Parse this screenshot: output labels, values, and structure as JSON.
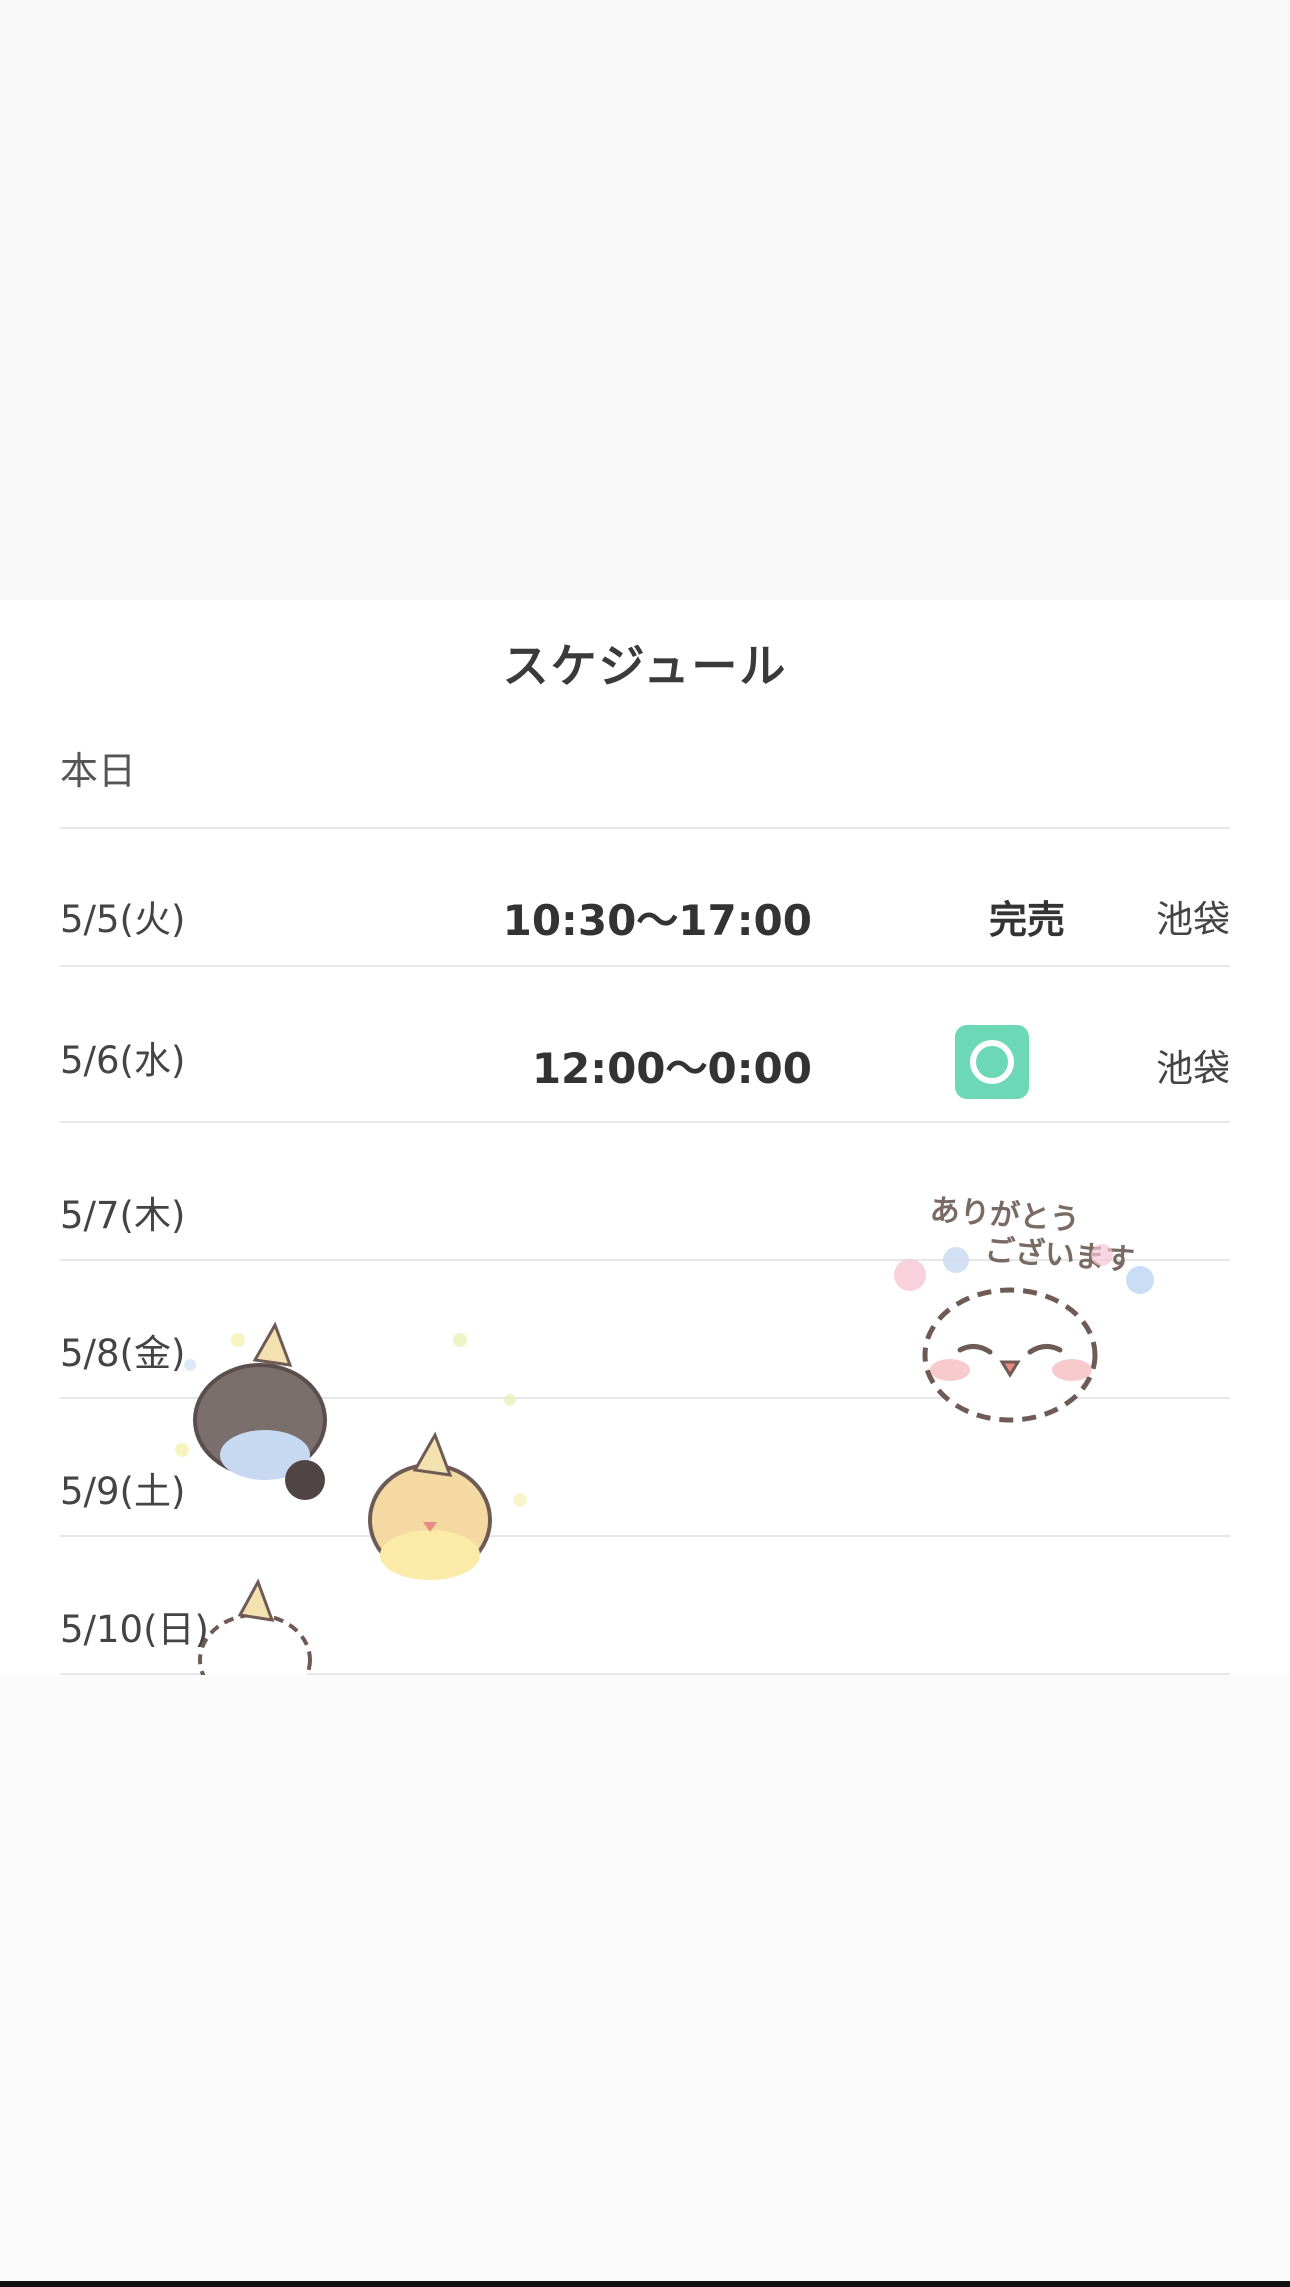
{
  "schedule": {
    "title": "スケジュール",
    "today_label": "本日",
    "rows": [
      {
        "date": "5/5(火)",
        "time": "10:30〜17:00",
        "status": "完売",
        "location": "池袋"
      },
      {
        "date": "5/6(水)",
        "time": "12:00〜0:00",
        "status_icon": "available-circle-icon",
        "location": "池袋"
      },
      {
        "date": "5/7(木)"
      },
      {
        "date": "5/8(金)"
      },
      {
        "date": "5/9(土)"
      },
      {
        "date": "5/10(日)"
      }
    ]
  },
  "sticker": {
    "thanks_line1": "ありがとう",
    "thanks_line2": "ございます"
  },
  "colors": {
    "available_badge": "#6dd8b5",
    "card_background": "#ffffff",
    "page_background": "#f8f8f8"
  }
}
